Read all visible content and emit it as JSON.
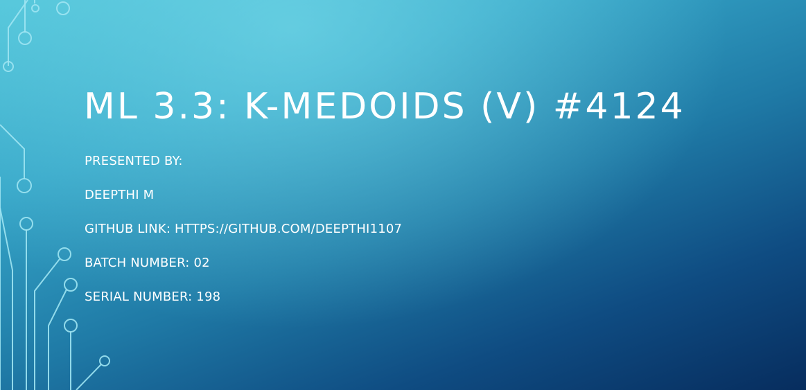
{
  "slide": {
    "title": "ML 3.3: K-MEDOIDS (V) #4124",
    "subtitle_lines": [
      "PRESENTED BY:",
      "DEEPTHI M",
      "GITHUB LINK: HTTPS://GITHUB.COM/DEEPTHI1107",
      "BATCH NUMBER: 02",
      "SERIAL NUMBER: 198"
    ]
  },
  "colors": {
    "background_light": "#4fc3d8",
    "background_dark": "#072d5e",
    "text": "#ffffff",
    "circuit_lines": "#9fe4f2"
  }
}
